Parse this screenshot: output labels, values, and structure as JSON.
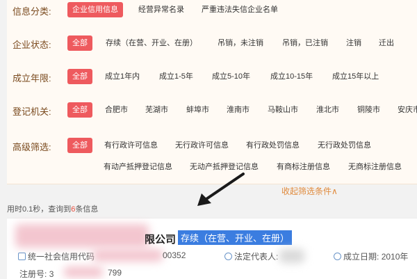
{
  "filters": {
    "info_category": {
      "label": "信息分类:",
      "options": [
        "企业信用信息",
        "经营异常名录",
        "严重违法失信企业名单"
      ]
    },
    "company_status": {
      "label": "企业状态:",
      "options": [
        "全部",
        "存续（在营、开业、在册）",
        "吊销，未注销",
        "吊销，已注销",
        "注销",
        "迁出"
      ]
    },
    "founded_years": {
      "label": "成立年限:",
      "options": [
        "全部",
        "成立1年内",
        "成立1-5年",
        "成立5-10年",
        "成立10-15年",
        "成立15年以上"
      ]
    },
    "registration_authority": {
      "label": "登记机关:",
      "options": [
        "全部",
        "合肥市",
        "芜湖市",
        "蚌埠市",
        "淮南市",
        "马鞍山市",
        "淮北市",
        "铜陵市",
        "安庆市"
      ]
    },
    "advanced": {
      "label": "高级筛选:",
      "options": [
        "全部",
        "有行政许可信息",
        "无行政许可信息",
        "有行政处罚信息",
        "无行政处罚信息",
        "有动产抵押登记信息",
        "无动产抵押登记信息",
        "有商标注册信息",
        "无商标注册信息"
      ]
    }
  },
  "collapse_label": "收起筛选条件∧",
  "result_summary": {
    "prefix": "用时0.1秒，查询到",
    "count": "6",
    "suffix": "条信息"
  },
  "result_card": {
    "company_name_visible": "限公司",
    "status": "存续（在营、开业、在册）",
    "credit_code_label": "统一社会信用代码",
    "credit_code_visible": "00352",
    "legal_rep_label": "法定代表人:",
    "founded_label": "成立日期:",
    "founded_value": "2010年",
    "reg_no_label": "注册号:",
    "reg_no_visible_start": "3",
    "reg_no_visible_end": "799"
  },
  "colors": {
    "active_tag": "#ee5a5e",
    "label_text": "#7a4a1e",
    "collapse_link": "#e08a3c",
    "status_badge": "#3b7de0",
    "result_count": "#e74c3c"
  }
}
